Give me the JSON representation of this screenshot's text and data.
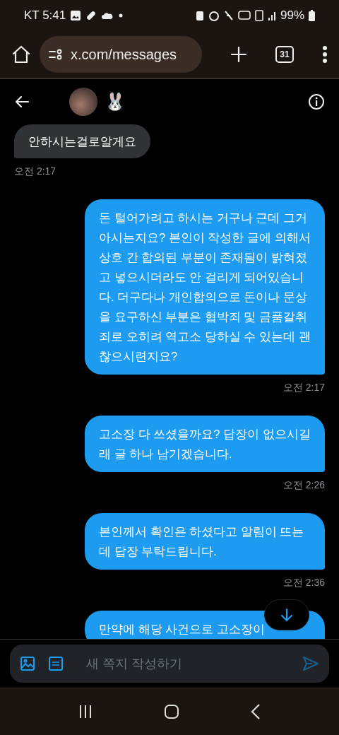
{
  "status_bar": {
    "carrier_time": "KT 5:41",
    "battery": "99%"
  },
  "browser": {
    "url": "x.com/messages",
    "tab_count": "31"
  },
  "chat_header": {
    "emoji": "🐰"
  },
  "messages": [
    {
      "kind": "received",
      "text": "안하시는걸로알게요",
      "time": "오전 2:17"
    },
    {
      "kind": "sent",
      "text": "돈 털어가려고 하시는 거구나 근데 그거 아시는지요? 본인이 작성한 글에 의해서 상호 간 합의된 부분이 존재됨이 밝혀졌고 넣으시더라도 안 걸리게 되어있습니다. 더구다나 개인합의으로 돈이나 문상을 요구하신 부분은 협박죄 및 금품갈취죄로 오히려 역고소 당하실 수 있는데 괜찮으시련지요?",
      "time": "오전 2:17"
    },
    {
      "kind": "sent",
      "text": "고소장 다 쓰셨을까요? 답장이 없으시길래 글 하나 남기겠습니다.",
      "time": "오전 2:26"
    },
    {
      "kind": "sent",
      "text": "본인께서 확인은 하셨다고 알림이 뜨는데 답장 부탁드립니다.",
      "time": "오전 2:36"
    },
    {
      "kind": "sent",
      "text": "만약에 해당 사건으로 고소장이"
    }
  ],
  "composer": {
    "placeholder": "새 쪽지 작성하기"
  }
}
